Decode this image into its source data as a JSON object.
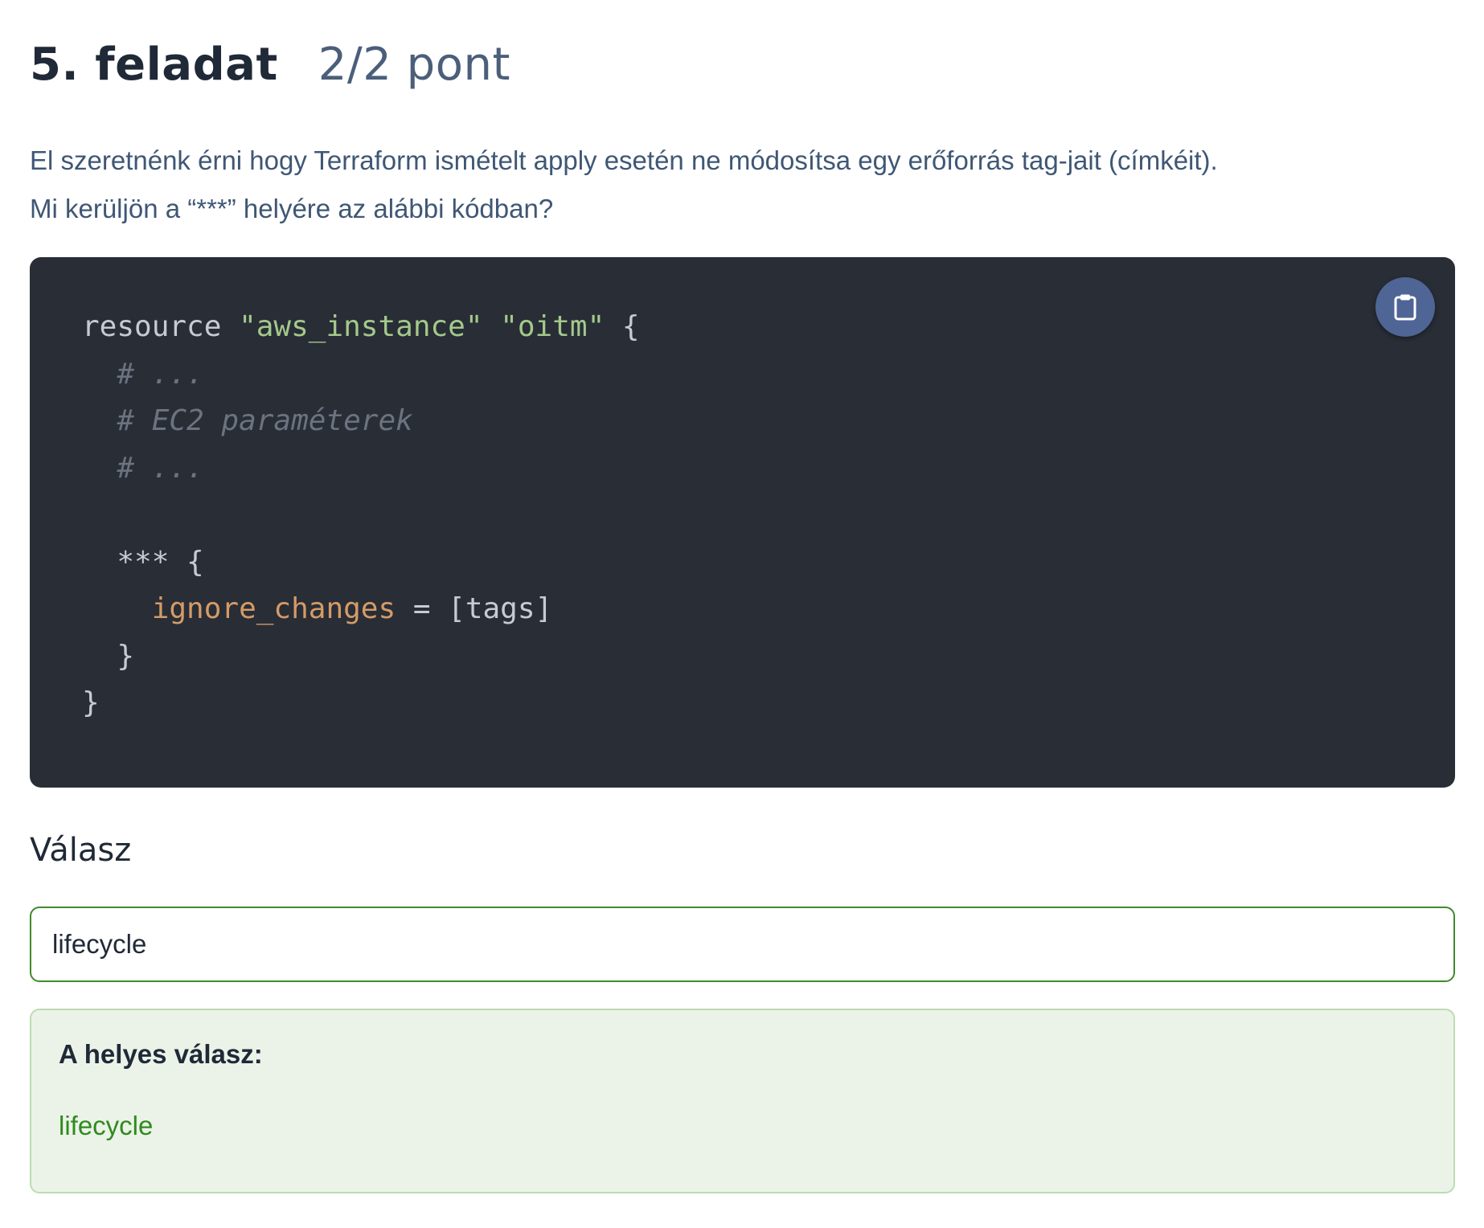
{
  "task": {
    "title": "5. feladat",
    "points": "2/2 pont"
  },
  "question": {
    "line1": "El szeretnénk érni hogy Terraform ismételt apply esetén ne módosítsa egy erőforrás tag-jait (címkéit).",
    "line2": "Mi kerüljön a “***” helyére az alábbi kódban?"
  },
  "code": {
    "copy_icon": "clipboard-icon",
    "lines": [
      [
        {
          "t": "plain",
          "v": "resource "
        },
        {
          "t": "str",
          "v": "\"aws_instance\""
        },
        {
          "t": "plain",
          "v": " "
        },
        {
          "t": "str",
          "v": "\"oitm\""
        },
        {
          "t": "plain",
          "v": " {"
        }
      ],
      [
        {
          "t": "com",
          "v": "  # ..."
        }
      ],
      [
        {
          "t": "com",
          "v": "  # EC2 paraméterek"
        }
      ],
      [
        {
          "t": "com",
          "v": "  # ..."
        }
      ],
      [],
      [
        {
          "t": "plain",
          "v": "  *** {"
        }
      ],
      [
        {
          "t": "plain",
          "v": "    "
        },
        {
          "t": "attr",
          "v": "ignore_changes"
        },
        {
          "t": "plain",
          "v": " = [tags]"
        }
      ],
      [
        {
          "t": "plain",
          "v": "  }"
        }
      ],
      [
        {
          "t": "plain",
          "v": "}"
        }
      ]
    ]
  },
  "answer": {
    "heading": "Válasz",
    "value": "lifecycle"
  },
  "correct": {
    "label": "A helyes válasz:",
    "value": "lifecycle"
  },
  "colors": {
    "code_bg": "#292d36",
    "string": "#a3c98b",
    "comment": "#6c7380",
    "attribute": "#d49b67",
    "success_border": "#3f8a2c",
    "success_bg": "#ebf3e8",
    "success_text": "#2f8a1f"
  }
}
